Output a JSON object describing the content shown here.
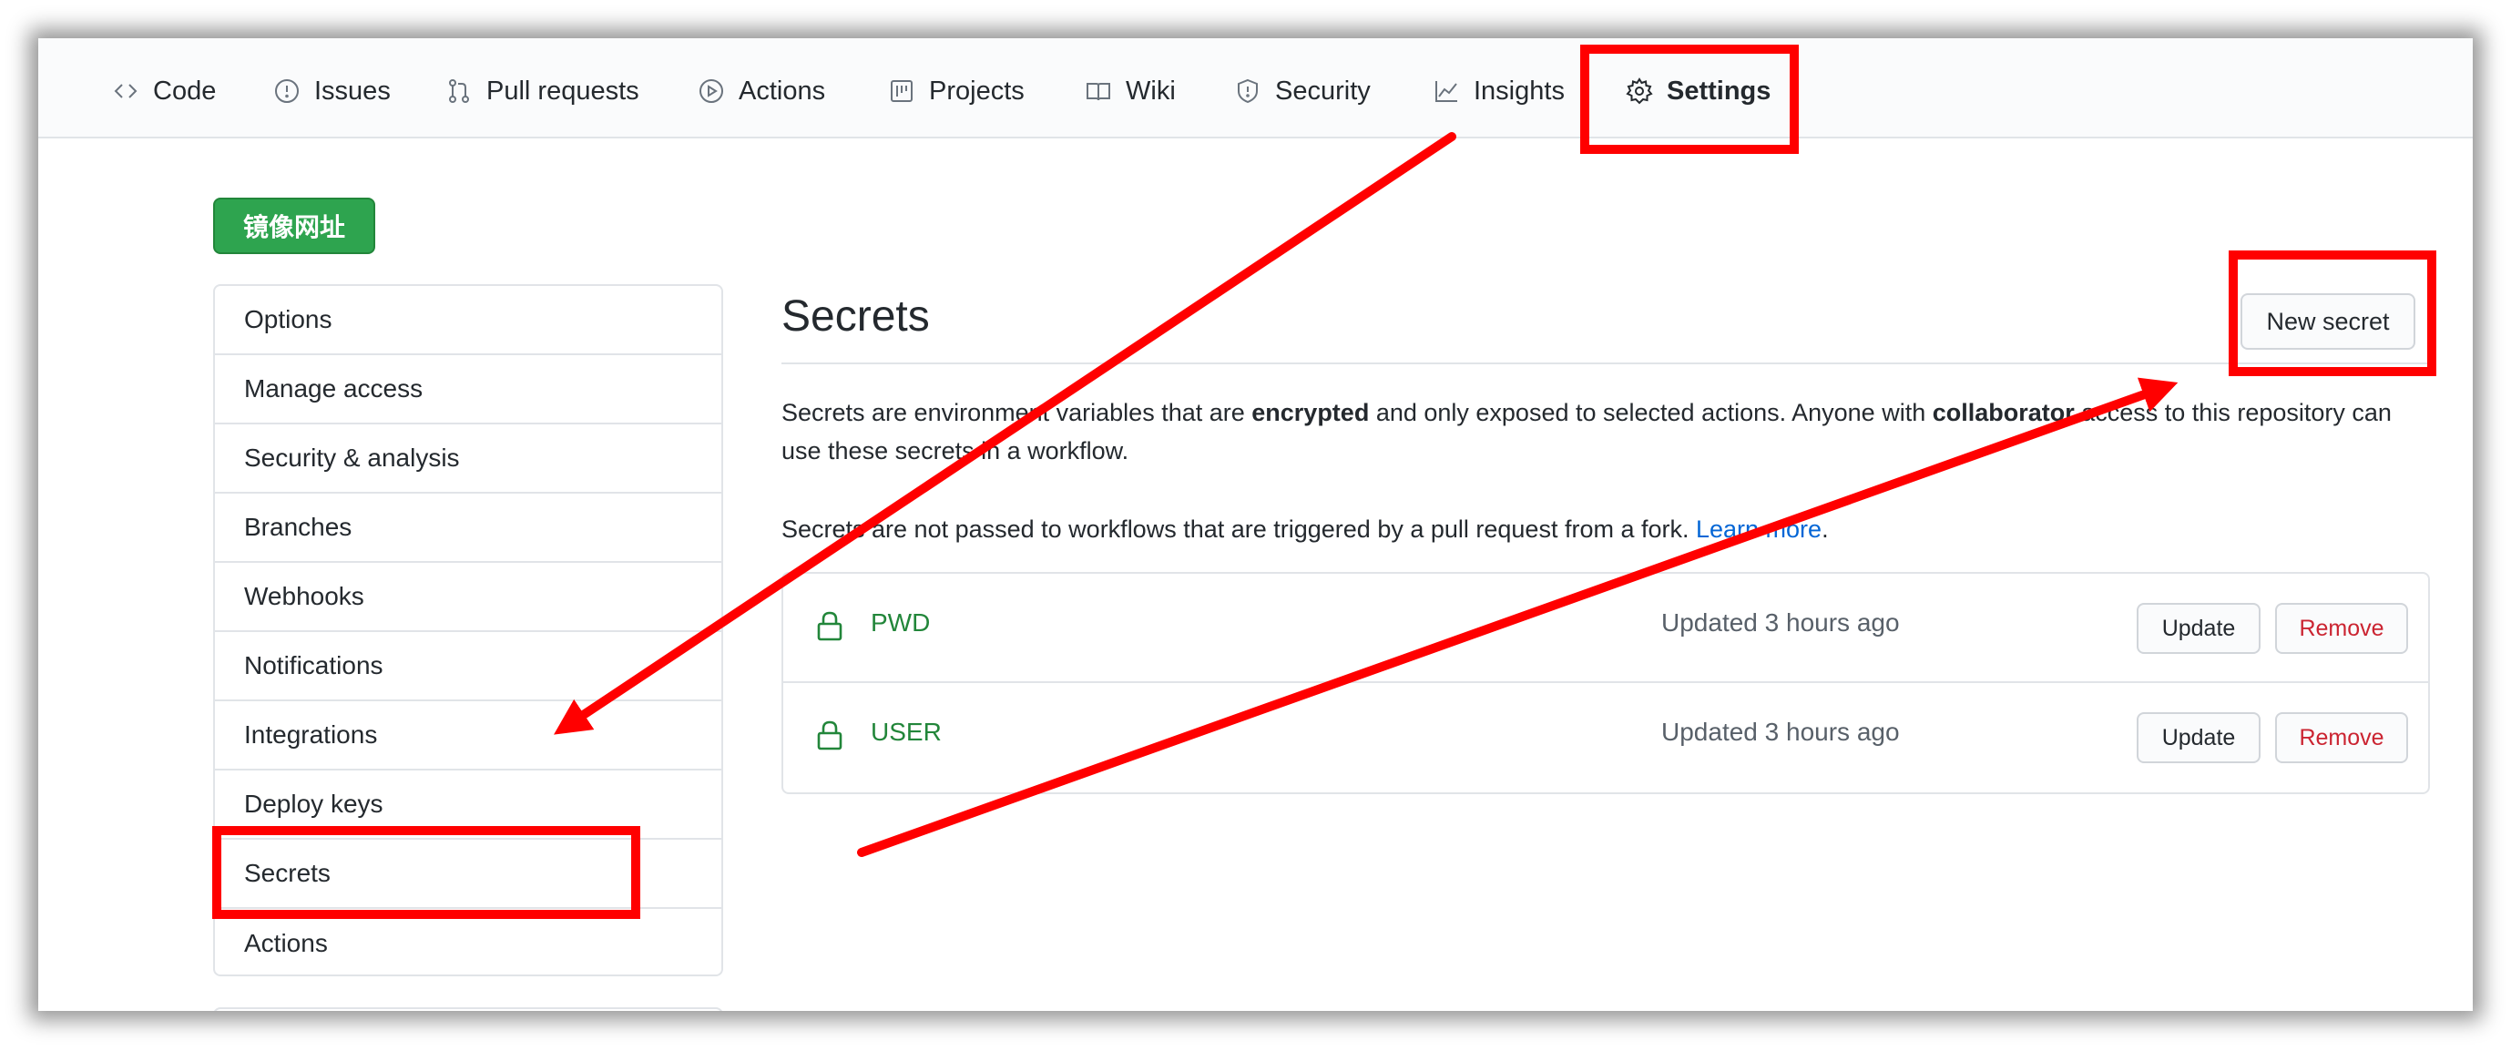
{
  "tabs": [
    {
      "label": "Code",
      "icon": "code-icon"
    },
    {
      "label": "Issues",
      "icon": "issue-opened-icon"
    },
    {
      "label": "Pull requests",
      "icon": "git-pull-request-icon"
    },
    {
      "label": "Actions",
      "icon": "play-icon"
    },
    {
      "label": "Projects",
      "icon": "project-icon"
    },
    {
      "label": "Wiki",
      "icon": "book-icon"
    },
    {
      "label": "Security",
      "icon": "shield-icon"
    },
    {
      "label": "Insights",
      "icon": "graph-icon"
    },
    {
      "label": "Settings",
      "icon": "gear-icon",
      "selected": true
    }
  ],
  "mirror_button": "镜像网址",
  "sidebar": {
    "items": [
      {
        "label": "Options"
      },
      {
        "label": "Manage access"
      },
      {
        "label": "Security & analysis"
      },
      {
        "label": "Branches"
      },
      {
        "label": "Webhooks"
      },
      {
        "label": "Notifications"
      },
      {
        "label": "Integrations"
      },
      {
        "label": "Deploy keys"
      },
      {
        "label": "Secrets"
      },
      {
        "label": "Actions"
      }
    ]
  },
  "main": {
    "title": "Secrets",
    "new_secret_label": "New secret",
    "desc1_a": "Secrets are environment variables that are ",
    "desc1_b": "encrypted",
    "desc1_c": " and only exposed to selected actions. Anyone with ",
    "desc1_d": "collaborator",
    "desc1_e": " access to this repository can use these secrets in a workflow.",
    "desc2_a": "Secrets are not passed to workflows that are triggered by a pull request from a fork. ",
    "desc2_link": "Learn more",
    "desc2_end": ".",
    "secrets": [
      {
        "name": "PWD",
        "updated": "Updated 3 hours ago",
        "update_label": "Update",
        "remove_label": "Remove"
      },
      {
        "name": "USER",
        "updated": "Updated 3 hours ago",
        "update_label": "Update",
        "remove_label": "Remove"
      }
    ]
  },
  "colors": {
    "annotation": "#ff0000",
    "green_button": "#2ea44f",
    "secret_name": "#22863a",
    "remove_text": "#cb2431",
    "link": "#0366d6"
  }
}
